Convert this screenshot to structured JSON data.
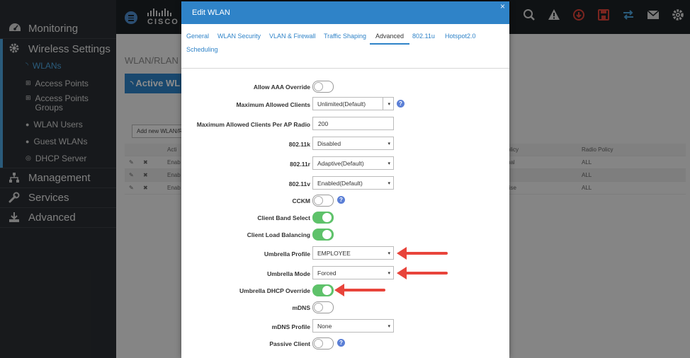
{
  "sidebar": {
    "items": [
      {
        "label": "Monitoring",
        "icon": "dashboard-icon"
      },
      {
        "label": "Wireless Settings",
        "icon": "gear-icon"
      },
      {
        "label": "WLANs",
        "icon": "wifi-icon"
      },
      {
        "label": "Access Points",
        "icon": "access-point-icon"
      },
      {
        "label": "Access Points Groups",
        "icon": "access-point-icon"
      },
      {
        "label": "WLAN Users",
        "icon": "users-icon"
      },
      {
        "label": "Guest WLANs",
        "icon": "users-icon"
      },
      {
        "label": "DHCP Server",
        "icon": "server-icon"
      },
      {
        "label": "Management",
        "icon": "network-icon"
      },
      {
        "label": "Services",
        "icon": "wrench-icon"
      },
      {
        "label": "Advanced",
        "icon": "download-icon"
      }
    ]
  },
  "topbar": {
    "logo": "CISCO",
    "icons": [
      "search-icon",
      "warning-icon",
      "download-circle-icon",
      "save-icon",
      "transfer-icon",
      "mail-icon",
      "settings-icon"
    ]
  },
  "background": {
    "page_title": "WLAN/RLAN C",
    "active_tab": "Active WL",
    "add_button": "Add new WLAN/RL",
    "col_action": "Acti",
    "col_policy": "olicy",
    "col_radio": "Radio Policy",
    "rows": [
      {
        "status": "Enab",
        "policy": "nal",
        "radio": "ALL"
      },
      {
        "status": "Enab",
        "policy": "",
        "radio": "ALL"
      },
      {
        "status": "Enab",
        "policy": "rise",
        "radio": "ALL"
      }
    ]
  },
  "modal": {
    "title": "Edit WLAN",
    "close": "×",
    "tabs": [
      "General",
      "WLAN Security",
      "VLAN & Firewall",
      "Traffic Shaping",
      "Advanced",
      "802.11u",
      "Hotspot2.0",
      "Scheduling"
    ],
    "active_tab": "Advanced",
    "fields": {
      "allow_aaa_override": {
        "label": "Allow AAA Override",
        "on": false
      },
      "max_clients": {
        "label": "Maximum Allowed Clients",
        "value": "Unlimited(Default)"
      },
      "max_clients_ap": {
        "label": "Maximum Allowed Clients Per AP Radio",
        "value": "200"
      },
      "k80211": {
        "label": "802.11k",
        "value": "Disabled"
      },
      "r80211": {
        "label": "802.11r",
        "value": "Adaptive(Default)"
      },
      "v80211": {
        "label": "802.11v",
        "value": "Enabled(Default)"
      },
      "cckm": {
        "label": "CCKM",
        "on": false
      },
      "client_band_select": {
        "label": "Client Band Select",
        "on": true
      },
      "client_load_balancing": {
        "label": "Client Load Balancing",
        "on": true
      },
      "umbrella_profile": {
        "label": "Umbrella Profile",
        "value": "EMPLOYEE"
      },
      "umbrella_mode": {
        "label": "Umbrella Mode",
        "value": "Forced"
      },
      "umbrella_dhcp_override": {
        "label": "Umbrella DHCP Override",
        "on": true
      },
      "mdns": {
        "label": "mDNS",
        "on": false
      },
      "mdns_profile": {
        "label": "mDNS Profile",
        "value": "None"
      },
      "passive_client": {
        "label": "Passive Client",
        "on": false
      }
    },
    "help": "?",
    "caret": "▾"
  },
  "colors": {
    "accent": "#2f83c8",
    "toggle_on": "#5ec26a",
    "arrow": "#e8443b"
  }
}
